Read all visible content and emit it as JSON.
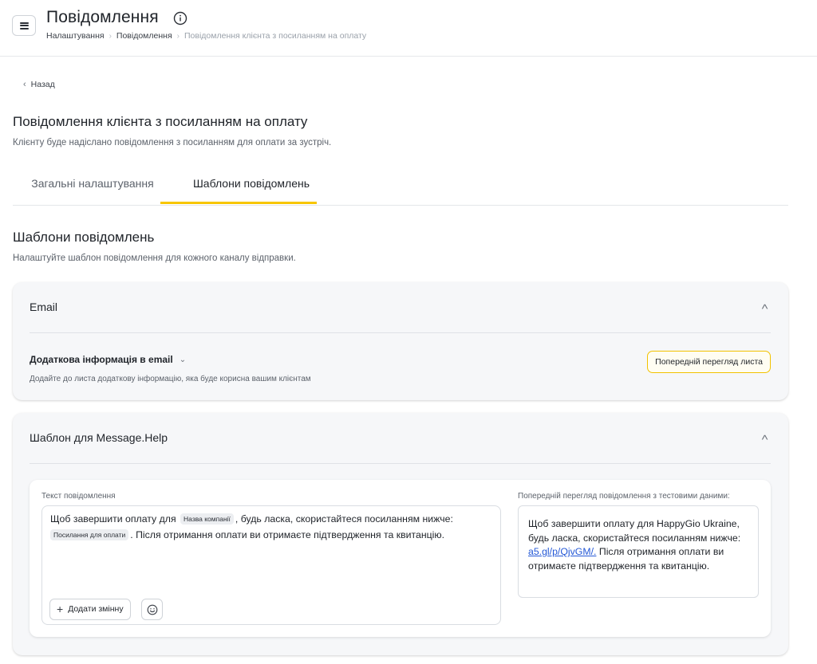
{
  "header": {
    "title": "Повідомлення",
    "breadcrumb": [
      "Налаштування",
      "Повідомлення",
      "Повідомлення клієнта з посиланням на оплату"
    ]
  },
  "back_label": "Назад",
  "section": {
    "title": "Повідомлення клієнта з посиланням на оплату",
    "description": "Клієнту буде надіслано повідомлення з посиланням для оплати за зустріч."
  },
  "tabs": [
    {
      "label": "Загальні налаштування",
      "active": false
    },
    {
      "label": "Шаблони повідомлень",
      "active": true
    }
  ],
  "templates": {
    "title": "Шаблони повідомлень",
    "description": "Налаштуйте шаблон повідомлення для кожного каналу відправки."
  },
  "email_card": {
    "title": "Email",
    "extra_title": "Додаткова інформація в email",
    "extra_desc": "Додайте до листа додаткову інформацію, яка буде корисна вашим клієнтам",
    "preview_button": "Попередній перегляд листа"
  },
  "mh_card": {
    "title": "Шаблон для Message.Help",
    "message_label": "Текст повідомлення",
    "message_parts": {
      "p1": "Щоб завершити оплату для",
      "var1": "Назва компанії",
      "p2": ", будь ласка, скористайтеся посиланням нижче:",
      "var2": "Посилання для оплати",
      "p3": ". Після отримання оплати ви отримаєте підтвердження та квитанцію."
    },
    "add_variable_button": "Додати змінну",
    "preview_label": "Попередній перегляд повідомлення з тестовими даними:",
    "preview": {
      "before": "Щоб завершити оплату для HappyGio Ukraine, будь ласка, скористайтеся посиланням нижче:",
      "link": "a5.gl/p/QjvGM/.",
      "after": "Після отримання оплати ви отримаєте підтвердження та квитанцію."
    }
  },
  "colors": {
    "accent": "#f7c600",
    "link": "#2458d6",
    "card_bg": "#f6f7f9"
  },
  "icons": [
    "menu-icon",
    "info-icon",
    "chevron-left-icon",
    "chevron-up-icon",
    "chevron-down-icon",
    "plus-icon",
    "emoji-icon"
  ]
}
